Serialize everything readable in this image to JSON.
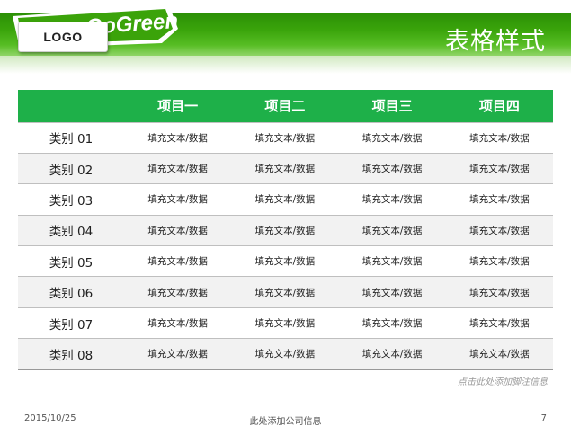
{
  "header": {
    "logo": "LOGO",
    "banner_text": "GoGreen!",
    "title": "表格样式"
  },
  "table": {
    "columns": [
      "",
      "项目一",
      "项目二",
      "项目三",
      "项目四"
    ],
    "rows": [
      {
        "category": "类别 01",
        "cells": [
          "填充文本/数据",
          "填充文本/数据",
          "填充文本/数据",
          "填充文本/数据"
        ]
      },
      {
        "category": "类别 02",
        "cells": [
          "填充文本/数据",
          "填充文本/数据",
          "填充文本/数据",
          "填充文本/数据"
        ]
      },
      {
        "category": "类别 03",
        "cells": [
          "填充文本/数据",
          "填充文本/数据",
          "填充文本/数据",
          "填充文本/数据"
        ]
      },
      {
        "category": "类别 04",
        "cells": [
          "填充文本/数据",
          "填充文本/数据",
          "填充文本/数据",
          "填充文本/数据"
        ]
      },
      {
        "category": "类别 05",
        "cells": [
          "填充文本/数据",
          "填充文本/数据",
          "填充文本/数据",
          "填充文本/数据"
        ]
      },
      {
        "category": "类别 06",
        "cells": [
          "填充文本/数据",
          "填充文本/数据",
          "填充文本/数据",
          "填充文本/数据"
        ]
      },
      {
        "category": "类别 07",
        "cells": [
          "填充文本/数据",
          "填充文本/数据",
          "填充文本/数据",
          "填充文本/数据"
        ]
      },
      {
        "category": "类别 08",
        "cells": [
          "填充文本/数据",
          "填充文本/数据",
          "填充文本/数据",
          "填充文本/数据"
        ]
      }
    ]
  },
  "footnote": "点击此处添加脚注信息",
  "footer": {
    "date": "2015/10/25",
    "company": "此处添加公司信息",
    "page": "7"
  },
  "colors": {
    "header_green": "#3aa40b",
    "table_header_green": "#1eb049",
    "row_alt": "#f2f2f2"
  }
}
